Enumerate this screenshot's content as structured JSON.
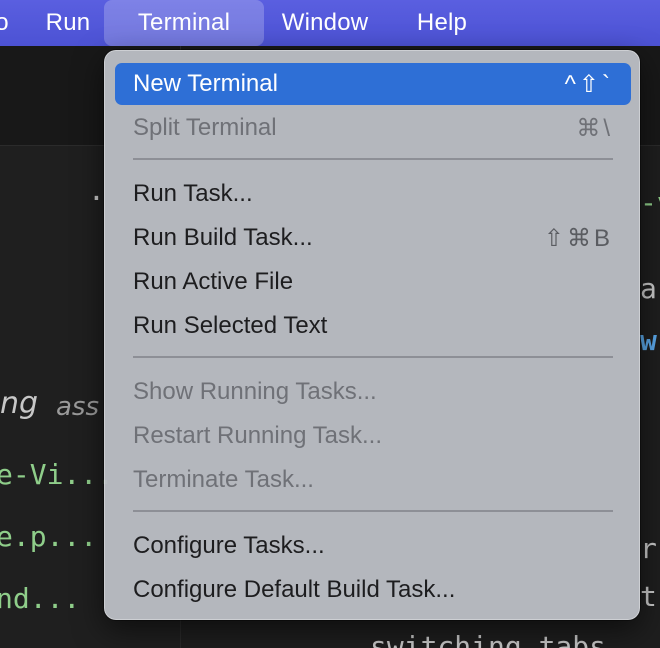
{
  "menubar": {
    "items": [
      {
        "label": "o"
      },
      {
        "label": "Run"
      },
      {
        "label": "Terminal"
      },
      {
        "label": "Window"
      },
      {
        "label": "Help"
      }
    ],
    "active": "Terminal"
  },
  "background_code": {
    "left": [
      {
        "text": "."
      },
      {
        "text": "ng"
      },
      {
        "text": "ass"
      },
      {
        "text": "e-Vi..."
      },
      {
        "text": "e.p..."
      },
      {
        "text": "nd..."
      }
    ],
    "right": [
      {
        "text": "-v"
      },
      {
        "text": "a"
      },
      {
        "text": "w"
      },
      {
        "text": "r"
      },
      {
        "text": "t"
      },
      {
        "text": "switching tabs"
      }
    ]
  },
  "terminal_menu": {
    "items": [
      {
        "label": "New Terminal",
        "shortcut": "^⇧`",
        "state": "highlighted"
      },
      {
        "label": "Split Terminal",
        "shortcut": "⌘\\",
        "state": "disabled"
      },
      {
        "label": "Run Task...",
        "shortcut": "",
        "state": "enabled"
      },
      {
        "label": "Run Build Task...",
        "shortcut": "⇧⌘B",
        "state": "enabled"
      },
      {
        "label": "Run Active File",
        "shortcut": "",
        "state": "enabled"
      },
      {
        "label": "Run Selected Text",
        "shortcut": "",
        "state": "enabled"
      },
      {
        "label": "Show Running Tasks...",
        "shortcut": "",
        "state": "disabled"
      },
      {
        "label": "Restart Running Task...",
        "shortcut": "",
        "state": "disabled"
      },
      {
        "label": "Terminate Task...",
        "shortcut": "",
        "state": "disabled"
      },
      {
        "label": "Configure Tasks...",
        "shortcut": "",
        "state": "enabled"
      },
      {
        "label": "Configure Default Build Task...",
        "shortcut": "",
        "state": "enabled"
      }
    ]
  },
  "colors": {
    "menubar": "#4c52d4",
    "highlight": "#2e6fd6",
    "menu_bg": "#babdc4",
    "code_green": "#8fce8a",
    "code_blue": "#5aa7e8"
  }
}
